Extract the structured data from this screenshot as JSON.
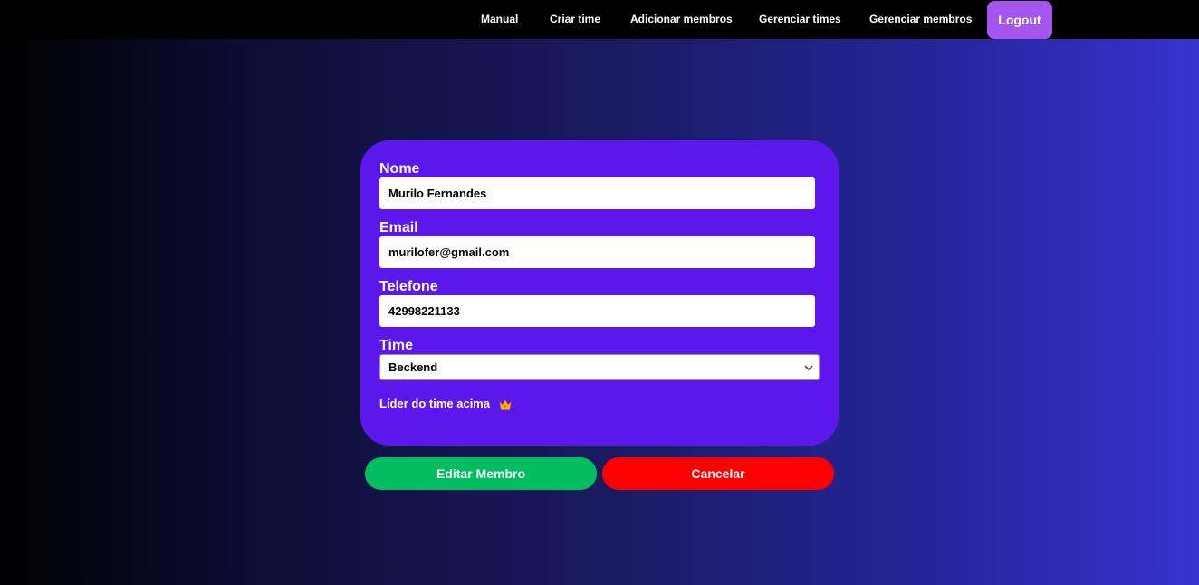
{
  "navbar": {
    "items": [
      {
        "label": "Manual"
      },
      {
        "label": "Criar time"
      },
      {
        "label": "Adicionar membros"
      },
      {
        "label": "Gerenciar times"
      },
      {
        "label": "Gerenciar membros"
      }
    ],
    "logout_label": "Logout",
    "logout_color": "#a355ee"
  },
  "form": {
    "name_label": "Nome",
    "name_value": "Murilo Fernandes",
    "email_label": "Email",
    "email_value": "murilofer@gmail.com",
    "phone_label": "Telefone",
    "phone_value": "42998221133",
    "team_label": "Time",
    "team_selected": "Beckend",
    "leader_note": "Líder do time acima",
    "leader_icon": "crown-icon",
    "card_color": "#5c17ec"
  },
  "actions": {
    "edit_label": "Editar Membro",
    "edit_color": "#00be5f",
    "cancel_label": "Cancelar",
    "cancel_color": "#ff0000"
  }
}
